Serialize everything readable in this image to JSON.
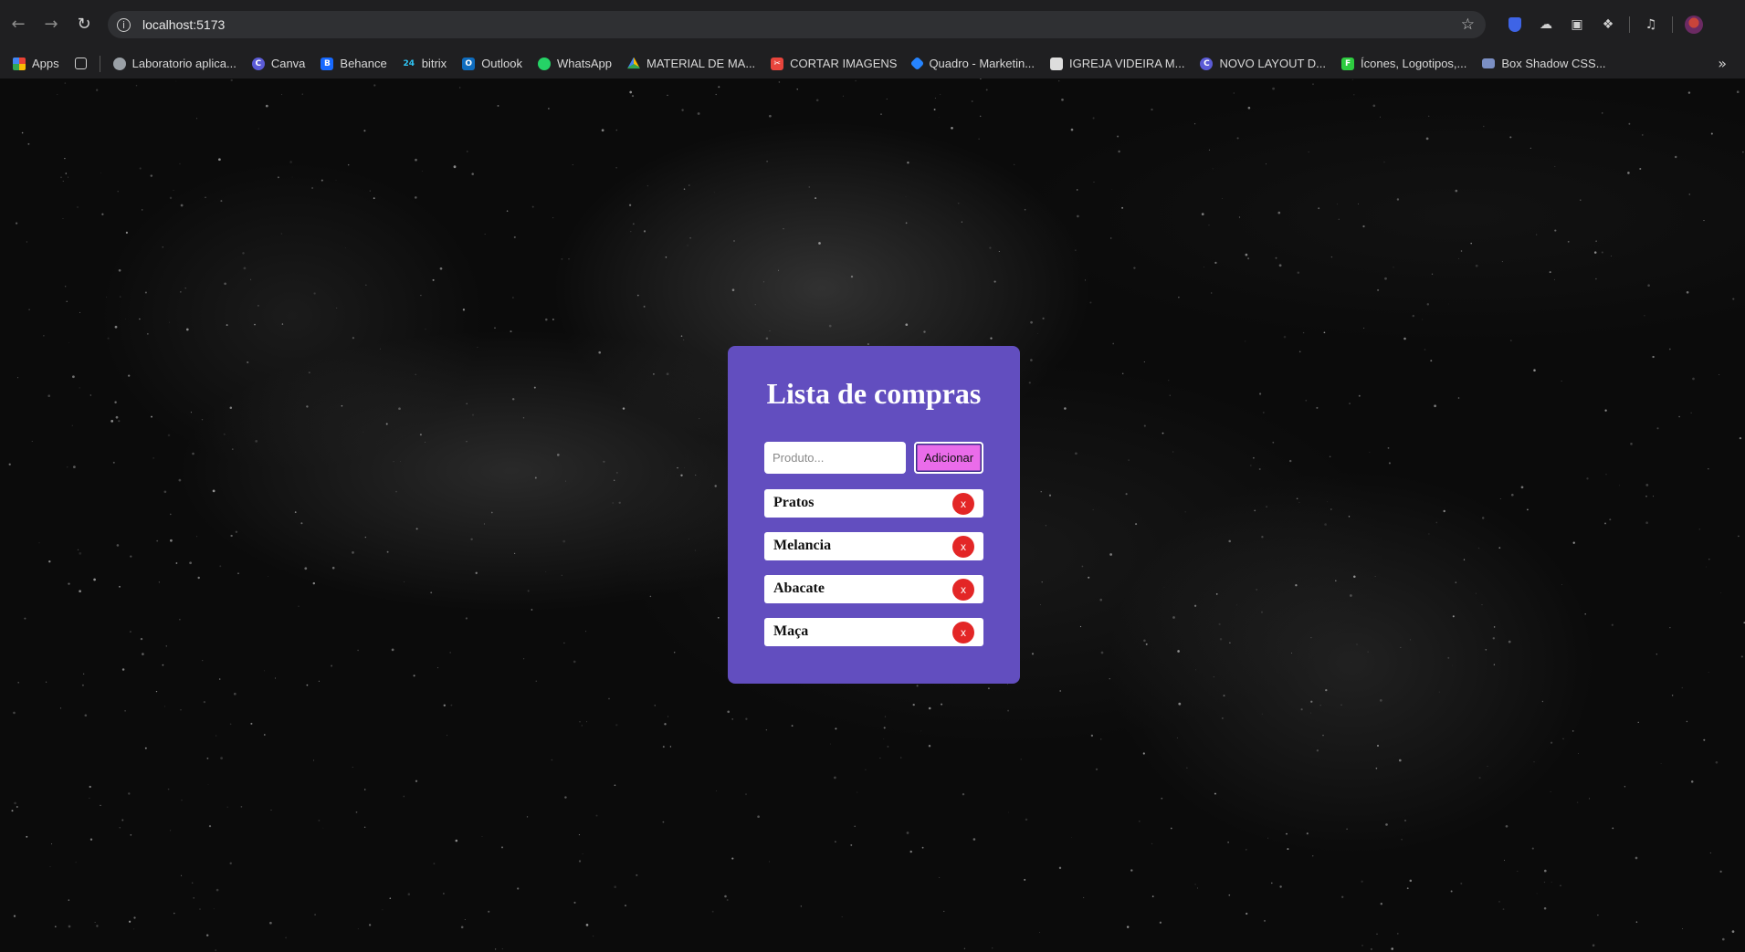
{
  "browser": {
    "url": "localhost:5173",
    "bookmarks": [
      {
        "label": "Apps",
        "icon": "apps-grid-icon",
        "color": "#e94235"
      },
      {
        "label": "Laboratorio aplica...",
        "icon": "globe-icon",
        "color": "#9aa0a6"
      },
      {
        "label": "Canva",
        "icon": "canva-icon",
        "color": "#5b5bd6"
      },
      {
        "label": "Behance",
        "icon": "behance-icon",
        "color": "#1769ff"
      },
      {
        "label": "bitrix",
        "icon": "bitrix-icon",
        "color": "#2fc6f6"
      },
      {
        "label": "Outlook",
        "icon": "outlook-icon",
        "color": "#0f6cbd"
      },
      {
        "label": "WhatsApp",
        "icon": "whatsapp-icon",
        "color": "#25d366"
      },
      {
        "label": "MATERIAL DE MA...",
        "icon": "google-drive-icon",
        "color": "#fbbc04"
      },
      {
        "label": "CORTAR IMAGENS",
        "icon": "cut-image-icon",
        "color": "#e8453c"
      },
      {
        "label": "Quadro - Marketin...",
        "icon": "jira-icon",
        "color": "#2684ff"
      },
      {
        "label": "IGREJA VIDEIRA M...",
        "icon": "trello-icon",
        "color": "#dddddd"
      },
      {
        "label": "NOVO LAYOUT D...",
        "icon": "canva-icon",
        "color": "#5b5bd6"
      },
      {
        "label": "Ícones, Logotipos,...",
        "icon": "flaticon-icon",
        "color": "#2ecc40"
      },
      {
        "label": "Box Shadow CSS...",
        "icon": "folder-icon",
        "color": "#7b8fc4"
      }
    ]
  },
  "app": {
    "title": "Lista de compras",
    "input_placeholder": "Produto...",
    "add_label": "Adicionar",
    "items": [
      {
        "name": "Pratos",
        "delete_label": "x"
      },
      {
        "name": "Melancia",
        "delete_label": "x"
      },
      {
        "name": "Abacate",
        "delete_label": "x"
      },
      {
        "name": "Maça",
        "delete_label": "x"
      }
    ]
  },
  "colors": {
    "card": "#624ebf",
    "add_button": "#ea6cea",
    "delete_button": "#e32626"
  }
}
